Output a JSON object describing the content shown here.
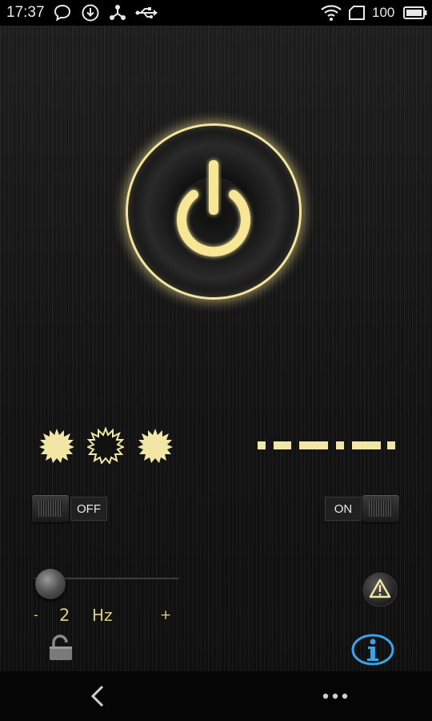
{
  "status_bar": {
    "time": "17:37",
    "icons": [
      "chat-icon",
      "download-icon",
      "share-icon",
      "usb-icon"
    ],
    "right_icons": [
      "wifi-icon",
      "sim-card-icon",
      "battery-icon"
    ],
    "battery": "100"
  },
  "power_button": {
    "icon": "power-icon",
    "glow_color": "#f6e696",
    "state": "on"
  },
  "strobe": {
    "indicators": [
      "sun-icon",
      "sun-outline-icon",
      "sun-icon"
    ],
    "morse_icon": "morse-code-icon"
  },
  "toggles": {
    "left": {
      "label": "OFF"
    },
    "right": {
      "label": "ON"
    }
  },
  "frequency": {
    "minus_label": "-",
    "value": "2",
    "unit": "Hz",
    "plus_label": "+",
    "slider_fraction": 0.06
  },
  "bottom": {
    "lock_icon": "lock-icon",
    "warning_icon": "warning-icon",
    "info_icon": "info-icon"
  },
  "nav": {
    "back_icon": "back-chevron-icon",
    "more_icon": "more-dots-icon"
  },
  "colors": {
    "accent": "#f2e6a6",
    "info_blue": "#3aa3e8",
    "background": "#141414"
  }
}
